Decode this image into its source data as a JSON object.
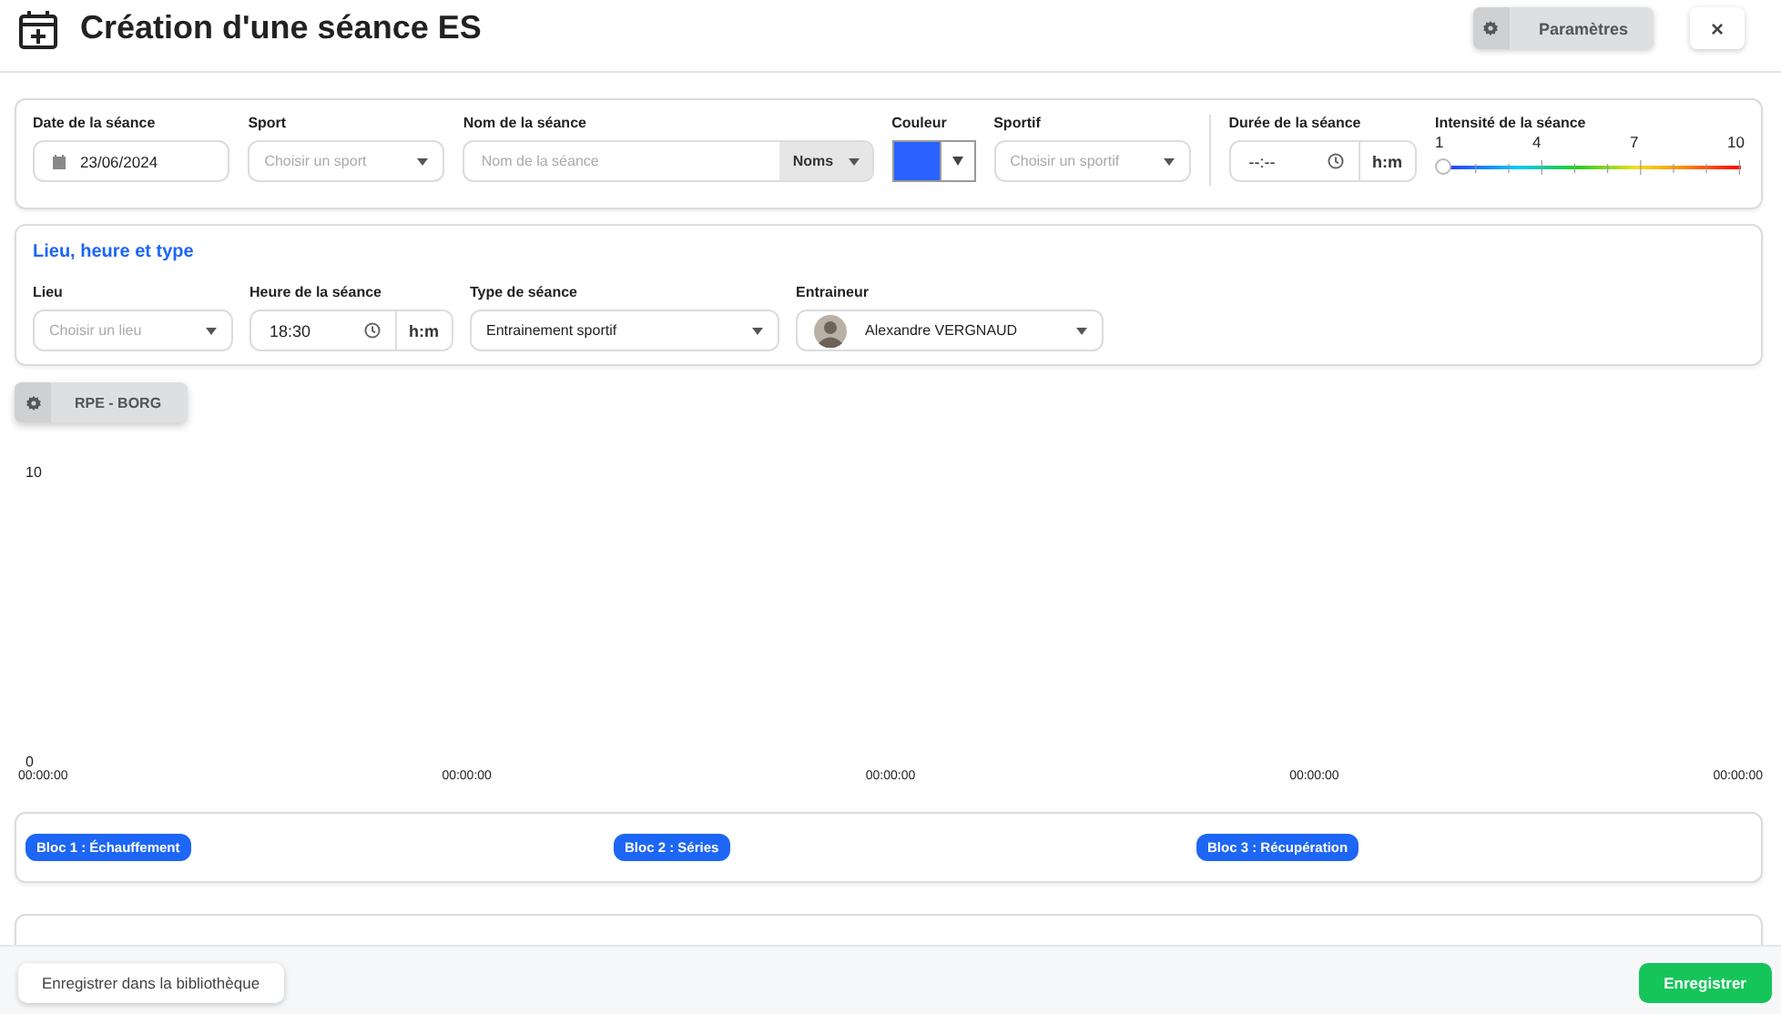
{
  "header": {
    "title": "Création d'une séance ES",
    "settings_button": "Paramètres",
    "close_button": "×"
  },
  "general": {
    "fields": [
      {
        "kind": "date",
        "label": "Date de la séance",
        "value": "23/06/2024"
      },
      {
        "kind": "select",
        "label": "Sport",
        "placeholder": "Choisir un sport"
      },
      {
        "kind": "text_addon",
        "label": "Nom de la séance",
        "placeholder": "Nom de la séance",
        "addon": "Noms"
      },
      {
        "kind": "color",
        "label": "Couleur",
        "color": "#2962ff"
      },
      {
        "kind": "select",
        "label": "Sportif",
        "placeholder": "Choisir un sportif"
      },
      {
        "kind": "time",
        "label": "Durée de la séance",
        "value": "--:--",
        "addon": "h:m"
      },
      {
        "kind": "slider",
        "label": "Intensité de la séance",
        "ticks": [
          "1",
          "4",
          "7",
          "10"
        ],
        "level": 0
      }
    ]
  },
  "details": {
    "title": "Lieu, heure et type",
    "fields": [
      {
        "kind": "select",
        "label": "Lieu",
        "placeholder": "Choisir un lieu"
      },
      {
        "kind": "time",
        "label": "Heure de la séance",
        "value": "18:30",
        "addon": "h:m"
      },
      {
        "kind": "select",
        "label": "Type de séance",
        "value": "Entrainement sportif"
      },
      {
        "kind": "person",
        "label": "Entraineur",
        "value": "Alexandre VERGNAUD"
      }
    ]
  },
  "rpe_button": "RPE - BORG",
  "chart": {
    "y_labels": [
      "10",
      "0"
    ],
    "x_labels": [
      "00:00:00",
      "00:00:00",
      "00:00:00",
      "00:00:00",
      "00:00:00"
    ]
  },
  "blocks": [
    {
      "label": "Bloc 1 : Échauffement"
    },
    {
      "label": "Bloc 2 : Séries"
    },
    {
      "label": "Bloc 3 : Récupération"
    }
  ],
  "footer": {
    "library_button": "Enregistrer dans la bibliothèque",
    "save_button": "Enregistrer"
  }
}
